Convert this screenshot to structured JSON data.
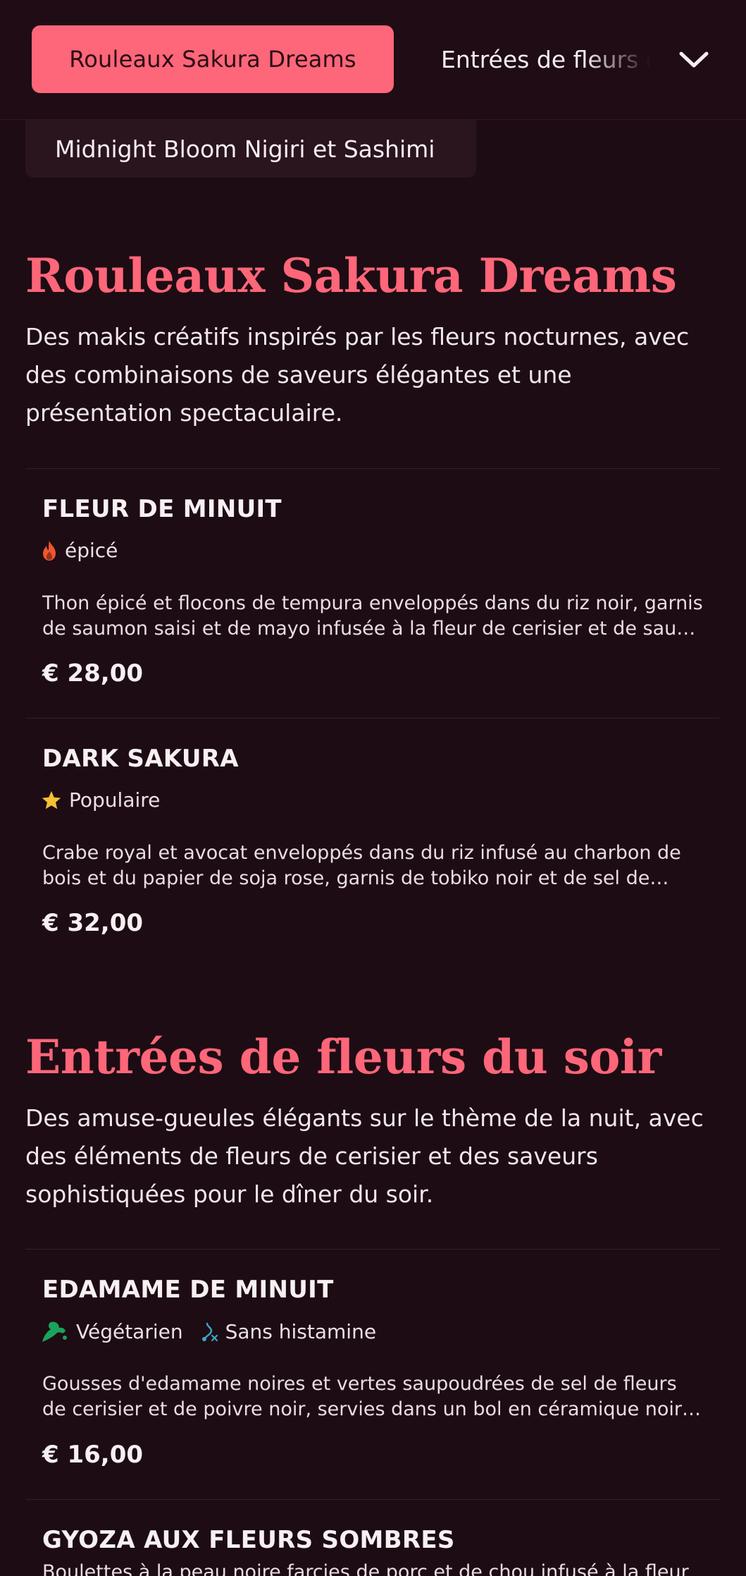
{
  "nav": {
    "active_tab": "Rouleaux Sakura Dreams",
    "next_tab": "Entrées de fleurs du soir",
    "chip_label": "Midnight Bloom Nigiri et Sashimi",
    "chevron_icon": "chevron-down-icon"
  },
  "sections": [
    {
      "title": "Rouleaux Sakura Dreams",
      "description": "Des makis créatifs inspirés par les fleurs nocturnes, avec des combinaisons de saveurs élégantes et une présentation spectaculaire.",
      "items": [
        {
          "name": "FLEUR DE MINUIT",
          "tags": [
            {
              "icon": "flame-icon",
              "label": "épicé"
            }
          ],
          "description": "Thon épicé et flocons de tempura enveloppés dans du riz noir, garnis de saumon saisi et de mayo infusée à la fleur de cerisier et de sauce anguille",
          "price": "€ 28,00"
        },
        {
          "name": "DARK SAKURA",
          "tags": [
            {
              "icon": "star-icon",
              "label": "Populaire"
            }
          ],
          "description": "Crabe royal et avocat enveloppés dans du riz infusé au charbon de bois et du papier de soja rose, garnis de tobiko noir et de sel de fleurs de cerisier",
          "price": "€ 32,00"
        }
      ]
    },
    {
      "title": "Entrées de fleurs du soir",
      "description": "Des amuse-gueules élégants sur le thème de la nuit, avec des éléments de fleurs de cerisier et des saveurs sophistiquées pour le dîner du soir.",
      "items": [
        {
          "name": "EDAMAME DE MINUIT",
          "tags": [
            {
              "icon": "vegetarian-icon",
              "label": "Végétarien"
            },
            {
              "icon": "histamine-free-icon",
              "label": "Sans histamine"
            }
          ],
          "description": "Gousses d'edamame noires et vertes saupoudrées de sel de fleurs de cerisier et de poivre noir, servies dans un bol en céramique noir mat",
          "price": "€ 16,00"
        },
        {
          "name": "GYOZA AUX FLEURS SOMBRES",
          "tags": [],
          "description": "Boulettes à la peau noire farcies de porc et de chou infusé à la fleur de cerisier",
          "price": ""
        }
      ]
    }
  ],
  "colors": {
    "background": "#1d0c14",
    "accent": "#fe6679",
    "chip": "#2a141e",
    "flame": "#f0562d",
    "star": "#f5c033",
    "vegetarian": "#19a35b",
    "histamine": "#3aa8c9"
  }
}
